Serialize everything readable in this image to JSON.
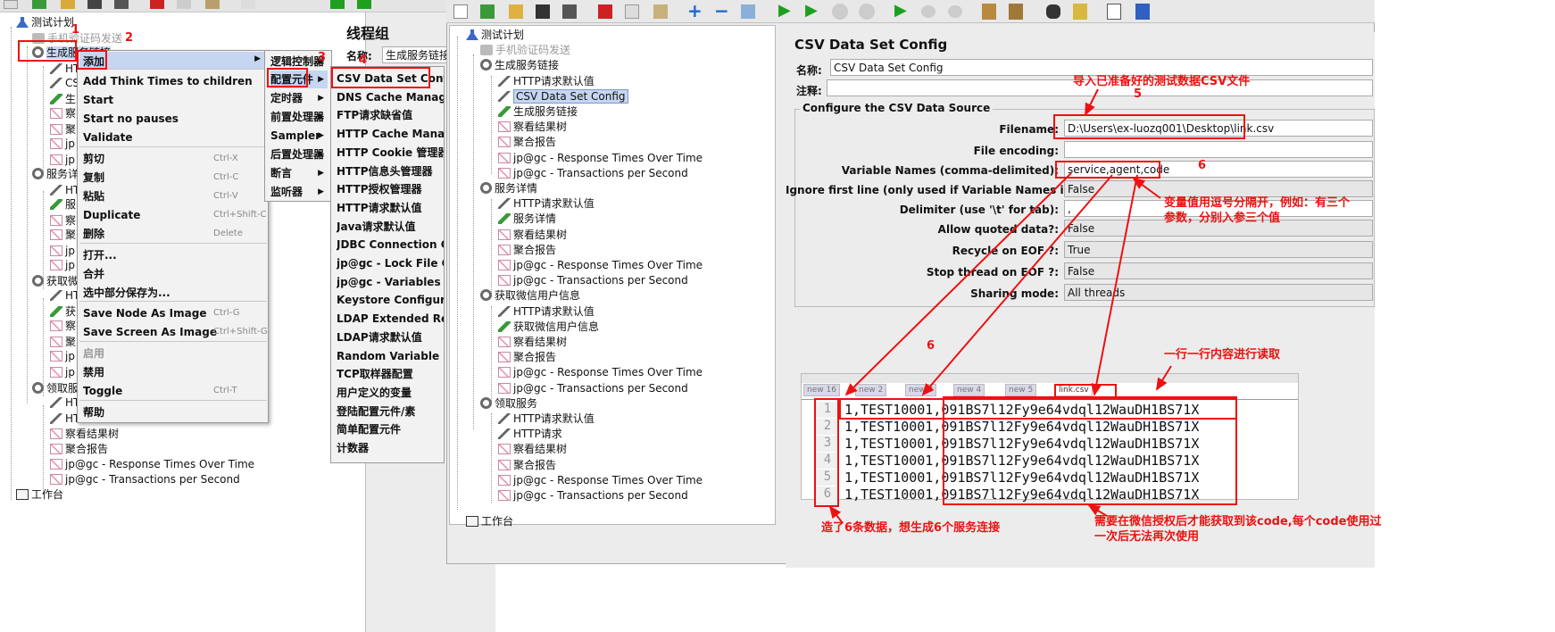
{
  "left_tree": {
    "items": [
      {
        "label": "测试计划"
      },
      {
        "label": "手机验证码发送"
      },
      {
        "label": "生成服务链接"
      },
      {
        "label": "HT"
      },
      {
        "label": "CS"
      },
      {
        "label": "生"
      },
      {
        "label": "察"
      },
      {
        "label": "聚"
      },
      {
        "label": "jp"
      },
      {
        "label": "jp"
      },
      {
        "label": "服务详"
      },
      {
        "label": "HT"
      },
      {
        "label": "服"
      },
      {
        "label": "察"
      },
      {
        "label": "聚"
      },
      {
        "label": "jp"
      },
      {
        "label": "jp"
      },
      {
        "label": "获取微"
      },
      {
        "label": "HT"
      },
      {
        "label": "获"
      },
      {
        "label": "察"
      },
      {
        "label": "聚"
      },
      {
        "label": "jp"
      },
      {
        "label": "jp"
      },
      {
        "label": "领取服"
      },
      {
        "label": "HT"
      },
      {
        "label": "HT"
      },
      {
        "label": "察看结果树"
      },
      {
        "label": "聚合报告"
      },
      {
        "label": "jp@gc - Response Times Over Time"
      },
      {
        "label": "jp@gc - Transactions per Second"
      },
      {
        "label": "工作台"
      }
    ]
  },
  "left_panel": {
    "title": "线程组",
    "name_label": "名称:",
    "name_value": "生成服务链接"
  },
  "context_menu": {
    "items": [
      {
        "label": "添加",
        "shortcut": ""
      },
      {
        "label": "Add Think Times to children",
        "shortcut": ""
      },
      {
        "label": "Start",
        "shortcut": ""
      },
      {
        "label": "Start no pauses",
        "shortcut": ""
      },
      {
        "label": "Validate",
        "shortcut": ""
      },
      {
        "label": "剪切",
        "shortcut": "Ctrl-X"
      },
      {
        "label": "复制",
        "shortcut": "Ctrl-C"
      },
      {
        "label": "粘贴",
        "shortcut": "Ctrl-V"
      },
      {
        "label": "Duplicate",
        "shortcut": "Ctrl+Shift-C"
      },
      {
        "label": "删除",
        "shortcut": "Delete"
      },
      {
        "label": "打开...",
        "shortcut": ""
      },
      {
        "label": "合并",
        "shortcut": ""
      },
      {
        "label": "选中部分保存为...",
        "shortcut": ""
      },
      {
        "label": "Save Node As Image",
        "shortcut": "Ctrl-G"
      },
      {
        "label": "Save Screen As Image",
        "shortcut": "Ctrl+Shift-G"
      },
      {
        "label": "启用",
        "shortcut": ""
      },
      {
        "label": "禁用",
        "shortcut": ""
      },
      {
        "label": "Toggle",
        "shortcut": "Ctrl-T"
      },
      {
        "label": "帮助",
        "shortcut": ""
      }
    ]
  },
  "submenu1": {
    "items": [
      "逻辑控制器",
      "配置元件",
      "定时器",
      "前置处理器",
      "Sampler",
      "后置处理器",
      "断言",
      "监听器"
    ]
  },
  "submenu2": {
    "items": [
      "CSV Data Set Config",
      "DNS Cache Manager",
      "FTP请求缺省值",
      "HTTP Cache Manager",
      "HTTP Cookie 管理器",
      "HTTP信息头管理器",
      "HTTP授权管理器",
      "HTTP请求默认值",
      "Java请求默认值",
      "JDBC Connection Config",
      "jp@gc - Lock File Config",
      "jp@gc - Variables From",
      "Keystore Configuration",
      "LDAP Extended Request",
      "LDAP请求默认值",
      "Random Variable",
      "TCP取样器配置",
      "用户定义的变量",
      "登陆配置元件/素",
      "简单配置元件",
      "计数器"
    ]
  },
  "right_tree": {
    "items": [
      {
        "label": "测试计划"
      },
      {
        "label": "手机验证码发送"
      },
      {
        "label": "生成服务链接"
      },
      {
        "label": "HTTP请求默认值"
      },
      {
        "label": "CSV Data Set Config"
      },
      {
        "label": "生成服务链接"
      },
      {
        "label": "察看结果树"
      },
      {
        "label": "聚合报告"
      },
      {
        "label": "jp@gc - Response Times Over Time"
      },
      {
        "label": "jp@gc - Transactions per Second"
      },
      {
        "label": "服务详情"
      },
      {
        "label": "HTTP请求默认值"
      },
      {
        "label": "服务详情"
      },
      {
        "label": "察看结果树"
      },
      {
        "label": "聚合报告"
      },
      {
        "label": "jp@gc - Response Times Over Time"
      },
      {
        "label": "jp@gc - Transactions per Second"
      },
      {
        "label": "获取微信用户信息"
      },
      {
        "label": "HTTP请求默认值"
      },
      {
        "label": "获取微信用户信息"
      },
      {
        "label": "察看结果树"
      },
      {
        "label": "聚合报告"
      },
      {
        "label": "jp@gc - Response Times Over Time"
      },
      {
        "label": "jp@gc - Transactions per Second"
      },
      {
        "label": "领取服务"
      },
      {
        "label": "HTTP请求默认值"
      },
      {
        "label": "HTTP请求"
      },
      {
        "label": "察看结果树"
      },
      {
        "label": "聚合报告"
      },
      {
        "label": "jp@gc - Response Times Over Time"
      },
      {
        "label": "jp@gc - Transactions per Second"
      },
      {
        "label": "工作台"
      }
    ]
  },
  "config": {
    "title": "CSV Data Set Config",
    "name_label": "名称:",
    "name_value": "CSV Data Set Config",
    "comment_label": "注释:",
    "group_title": "Configure the CSV Data Source",
    "fields": [
      {
        "label": "Filename:",
        "value": "D:\\Users\\ex-luozq001\\Desktop\\link.csv",
        "gray": false
      },
      {
        "label": "File encoding:",
        "value": "",
        "gray": false
      },
      {
        "label": "Variable Names (comma-delimited):",
        "value": "service,agent,code",
        "gray": false
      },
      {
        "label": "Ignore first line (only used if Variable Names is not empty):",
        "value": "False",
        "gray": true
      },
      {
        "label": "Delimiter (use '\\t' for tab):",
        "value": ",",
        "gray": false
      },
      {
        "label": "Allow quoted data?:",
        "value": "False",
        "gray": true
      },
      {
        "label": "Recycle on EOF ?:",
        "value": "True",
        "gray": true
      },
      {
        "label": "Stop thread on EOF ?:",
        "value": "False",
        "gray": true
      },
      {
        "label": "Sharing mode:",
        "value": "All threads",
        "gray": true
      }
    ]
  },
  "csv": {
    "tabs": [
      "new 16",
      "new 2",
      "new 3",
      "new 4",
      "new 5",
      "link.csv"
    ],
    "lines": [
      {
        "num": "1",
        "text": "1,TEST10001,091BS7l12Fy9e64vdql12WauDH1BS71X"
      },
      {
        "num": "2",
        "text": "1,TEST10001,091BS7l12Fy9e64vdql12WauDH1BS71X"
      },
      {
        "num": "3",
        "text": "1,TEST10001,091BS7l12Fy9e64vdql12WauDH1BS71X"
      },
      {
        "num": "4",
        "text": "1,TEST10001,091BS7l12Fy9e64vdql12WauDH1BS71X"
      },
      {
        "num": "5",
        "text": "1,TEST10001,091BS7l12Fy9e64vdql12WauDH1BS71X"
      },
      {
        "num": "6",
        "text": "1,TEST10001,091BS7l12Fy9e64vdql12WauDH1BS71X"
      }
    ]
  },
  "annotations": {
    "n1": "1",
    "n2": "2",
    "n3": "3",
    "n4": "4",
    "n5": "5",
    "n6a": "6",
    "n6b": "6",
    "import_csv": "导入已准备好的测试数据CSV文件",
    "var_names_line1": "变量值用逗号分隔开，例如：有三个",
    "var_names_line2": "参数，分别入参三个值",
    "read_line": "一行一行内容进行读取",
    "made_6": "造了6条数据，想生成6个服务连接",
    "need_wechat_line1": "需要在微信授权后才能获取到该code,每个code使用过",
    "need_wechat_line2": "一次后无法再次使用"
  },
  "colors": {
    "annotation": "#ee1111",
    "selection": "#c6d6f0"
  }
}
